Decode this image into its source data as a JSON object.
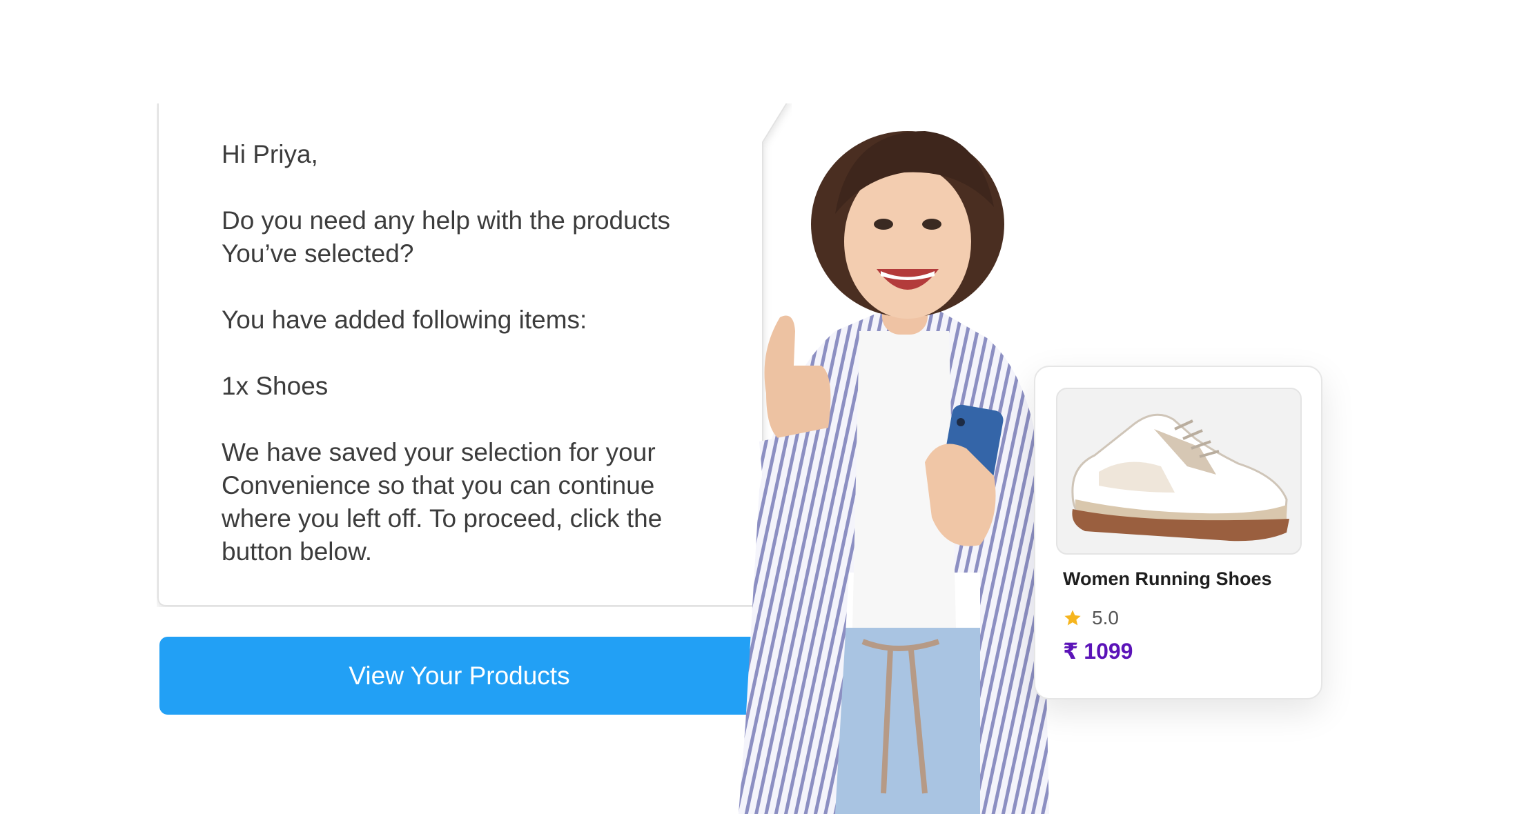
{
  "message": {
    "lines": [
      "Hi Priya,",
      "Do you need any help with the products You’ve selected?",
      "You have added following items:",
      "1x Shoes",
      "We have saved your selection for your Convenience so that you can continue where you left off. To proceed, click the button below."
    ]
  },
  "cta": {
    "label": "View Your Products"
  },
  "product": {
    "name": "Women Running Shoes",
    "rating": "5.0",
    "currency": "₹",
    "price": "1099",
    "icons": {
      "rating": "star-icon",
      "image": "sneaker-image"
    }
  },
  "colors": {
    "cta_background": "#22a0f5",
    "price": "#5b13b8",
    "star": "#f6b51e",
    "message_text": "#3c3c3c"
  }
}
